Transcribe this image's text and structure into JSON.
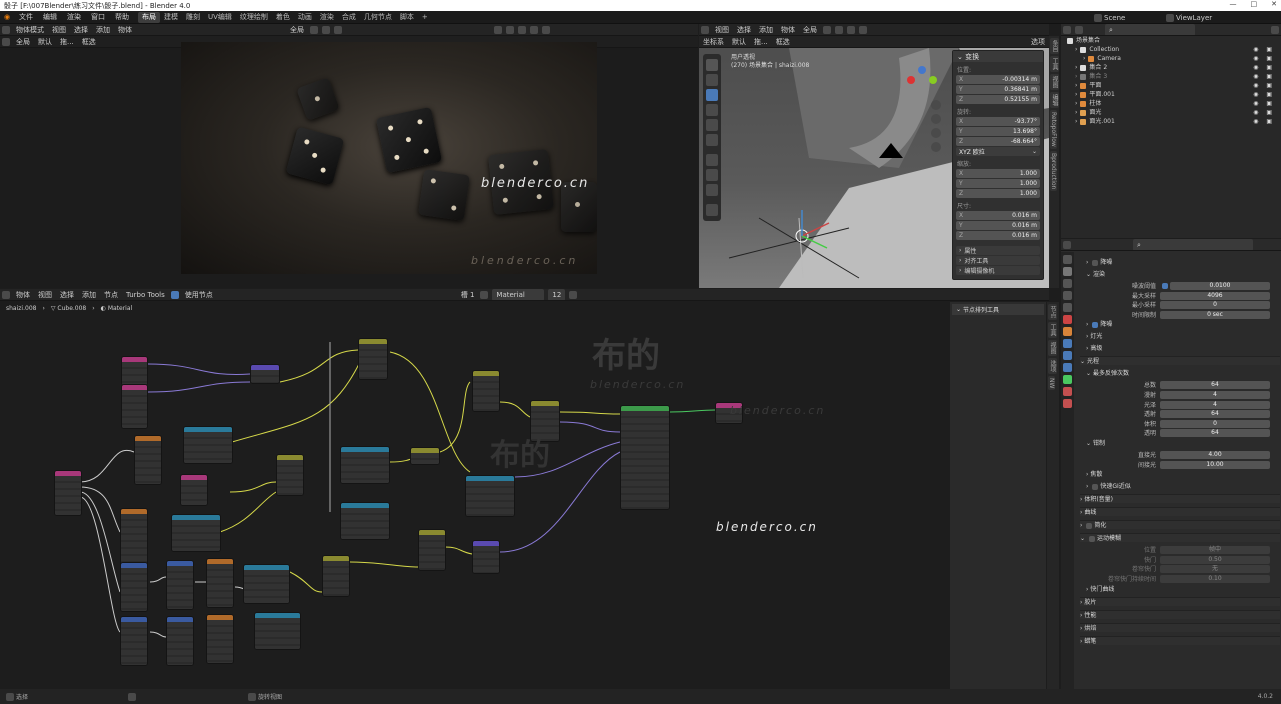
{
  "titlebar": {
    "title": "骰子 [F:\\007Blender\\练习文件\\骰子.blend] - Blender 4.0",
    "minimize": "—",
    "maximize": "□",
    "close": "✕"
  },
  "menu": [
    "文件",
    "编辑",
    "渲染",
    "窗口",
    "帮助"
  ],
  "workspaces": [
    {
      "label": "布局",
      "active": true
    },
    {
      "label": "建模"
    },
    {
      "label": "雕刻"
    },
    {
      "label": "UV编辑"
    },
    {
      "label": "纹理绘制"
    },
    {
      "label": "着色"
    },
    {
      "label": "动画"
    },
    {
      "label": "渲染"
    },
    {
      "label": "合成"
    },
    {
      "label": "几何节点"
    },
    {
      "label": "脚本"
    },
    {
      "label": "+"
    }
  ],
  "scene": {
    "name": "Scene",
    "view_layer": "ViewLayer"
  },
  "header_left": {
    "mode": "物体模式",
    "view": "视图",
    "select": "选择",
    "add": "添加",
    "object": "物体",
    "orientation": "全局",
    "transform_label": "全局",
    "drag": "默认",
    "drag_label": "拖...",
    "select_box": "框选"
  },
  "viewport_header": {
    "view": "视图",
    "select": "选择",
    "add": "添加",
    "object": "物体",
    "orientation": "全局",
    "options": "选项",
    "perspective": "用户透视",
    "collection": "(270) 场景集合 | shaizi.008",
    "coordinate": "坐标系",
    "pivot": "默认",
    "drag_label": "拖...",
    "select_box": "框选"
  },
  "render_watermark": "blenderco.cn",
  "render_watermark_2": "blenderco.cn",
  "transform_panel": {
    "header": "变换",
    "location_label": "位置:",
    "location": [
      {
        "axis": "X",
        "value": "-0.00314 m"
      },
      {
        "axis": "Y",
        "value": "0.36841 m"
      },
      {
        "axis": "Z",
        "value": "0.52155 m"
      }
    ],
    "rotation_label": "旋转:",
    "rotation": [
      {
        "axis": "X",
        "value": "-93.77°"
      },
      {
        "axis": "Y",
        "value": "13.698°"
      },
      {
        "axis": "Z",
        "value": "-68.664°"
      }
    ],
    "rotation_mode": "XYZ 欧拉",
    "scale_label": "缩放:",
    "scale": [
      {
        "axis": "X",
        "value": "1.000"
      },
      {
        "axis": "Y",
        "value": "1.000"
      },
      {
        "axis": "Z",
        "value": "1.000"
      }
    ],
    "dimensions_label": "尺寸:",
    "dimensions": [
      {
        "axis": "X",
        "value": "0.016 m"
      },
      {
        "axis": "Y",
        "value": "0.016 m"
      },
      {
        "axis": "Z",
        "value": "0.016 m"
      }
    ],
    "sections": [
      "属性",
      "对齐工具",
      "编辑摄像机"
    ]
  },
  "viewport_tabs": [
    "条目",
    "工具",
    "视图",
    "编辑",
    "RetopoFlow",
    "Bproduction"
  ],
  "node_header": {
    "mode": "物体",
    "view": "视图",
    "select": "选择",
    "add": "添加",
    "node": "节点",
    "turbo": "Turbo Tools",
    "use_nodes": "使用节点",
    "slot": "槽 1",
    "material": "Material",
    "users": "12"
  },
  "breadcrumb": {
    "object": "shaizi.008",
    "mesh": "Cube.008",
    "material": "Material"
  },
  "node_sidebar": {
    "title": "节点排列工具"
  },
  "node_watermarks": {
    "cn": "布的",
    "en": "blenderco.cn",
    "cn2": "布的",
    "en2": "blenderco.cn",
    "en3": "blenderco.cn"
  },
  "node_tabs": [
    "节点",
    "工具",
    "视图",
    "选项",
    "NW"
  ],
  "outliner": {
    "root": "场景集合",
    "items": [
      {
        "label": "Collection",
        "color": "#d0d0d0",
        "icon": "#ddd"
      },
      {
        "label": "Camera",
        "color": "#d0d0d0",
        "icon": "#e08a3c"
      },
      {
        "label": "集合 2",
        "color": "#d0d0d0",
        "icon": "#ddd"
      },
      {
        "label": "集合 3",
        "color": "#888",
        "icon": "#777"
      },
      {
        "label": "平面",
        "color": "#d0d0d0",
        "icon": "#e08a3c"
      },
      {
        "label": "平面.001",
        "color": "#d0d0d0",
        "icon": "#e08a3c"
      },
      {
        "label": "柱体",
        "color": "#d0d0d0",
        "icon": "#e08a3c"
      },
      {
        "label": "面光",
        "color": "#d0d0d0",
        "icon": "#e0a050"
      },
      {
        "label": "面光.001",
        "color": "#d0d0d0",
        "icon": "#e0a050"
      }
    ]
  },
  "properties": {
    "rows": [
      {
        "type": "section",
        "label": "降噪",
        "checkbox": false
      },
      {
        "type": "section",
        "label": "渲染",
        "open": true
      },
      {
        "type": "field",
        "label": "噪波阈值",
        "value": "0.0100",
        "checkbox": true
      },
      {
        "type": "field",
        "label": "最大采样",
        "value": "4096"
      },
      {
        "type": "field",
        "label": "最小采样",
        "value": "0"
      },
      {
        "type": "field",
        "label": "时间限制",
        "value": "0 sec"
      },
      {
        "type": "section",
        "label": "降噪",
        "checkbox": true
      },
      {
        "type": "section",
        "label": "灯光"
      },
      {
        "type": "section",
        "label": "高级"
      },
      {
        "type": "section",
        "label": "光程",
        "open": true,
        "top": true
      },
      {
        "type": "section",
        "label": "最多反弹次数",
        "open": true
      },
      {
        "type": "field",
        "label": "总数",
        "value": "64"
      },
      {
        "type": "field",
        "label": "漫射",
        "value": "4"
      },
      {
        "type": "field",
        "label": "光泽",
        "value": "4"
      },
      {
        "type": "field",
        "label": "透射",
        "value": "64"
      },
      {
        "type": "field",
        "label": "体积",
        "value": "0"
      },
      {
        "type": "field",
        "label": "透明",
        "value": "64"
      },
      {
        "type": "section",
        "label": "钳制",
        "open": true
      },
      {
        "type": "field",
        "label": "直接光",
        "value": "4.00"
      },
      {
        "type": "field",
        "label": "间接光",
        "value": "10.00"
      },
      {
        "type": "section",
        "label": "焦散"
      },
      {
        "type": "section",
        "label": "快速GI近似",
        "checkbox": false
      },
      {
        "type": "section",
        "label": "体积(音量)",
        "top": true
      },
      {
        "type": "section",
        "label": "曲线",
        "top": true
      },
      {
        "type": "section",
        "label": "简化",
        "top": true,
        "checkbox": false
      },
      {
        "type": "section",
        "label": "运动模糊",
        "top": true,
        "open": true,
        "checkbox": false
      },
      {
        "type": "field",
        "label": "位置",
        "value": "帧中",
        "dim": true
      },
      {
        "type": "field",
        "label": "快门",
        "value": "0.50",
        "dim": true
      },
      {
        "type": "field",
        "label": "卷帘快门",
        "value": "无",
        "dim": true
      },
      {
        "type": "field",
        "label": "卷帘快门持续时间",
        "value": "0.10",
        "dim": true
      },
      {
        "type": "section",
        "label": "快门曲线"
      },
      {
        "type": "section",
        "label": "胶片",
        "top": true
      },
      {
        "type": "section",
        "label": "性能",
        "top": true
      },
      {
        "type": "section",
        "label": "烘焙",
        "top": true
      },
      {
        "type": "section",
        "label": "蜡笔",
        "top": true
      }
    ]
  },
  "status": {
    "left": "选择",
    "center": "旋转视图",
    "version": "4.0.2"
  }
}
